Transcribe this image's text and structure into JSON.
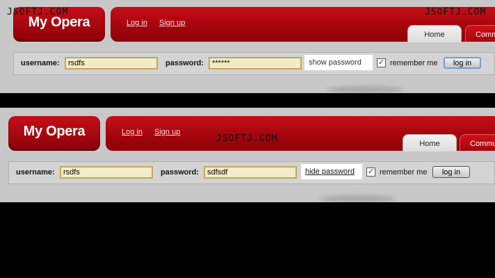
{
  "watermark": "JSOFTJ.COM",
  "logo": "My Opera",
  "nav": {
    "login_link": "Log in",
    "signup_link": "Sign up"
  },
  "tabs": {
    "home": "Home",
    "community": "Commu"
  },
  "top": {
    "username_label": "username:",
    "username_value": "rsdfs",
    "password_label": "password:",
    "password_value": "******",
    "toggle_label": "show password",
    "remember_label": "remember me",
    "remember_checked": true,
    "login_button": "log in"
  },
  "bottom": {
    "username_label": "username:",
    "username_value": "rsdfs",
    "password_label": "password:",
    "password_value": "sdfsdf",
    "toggle_label": "hide password",
    "remember_label": "remember me",
    "remember_checked": true,
    "login_button": "log in"
  }
}
